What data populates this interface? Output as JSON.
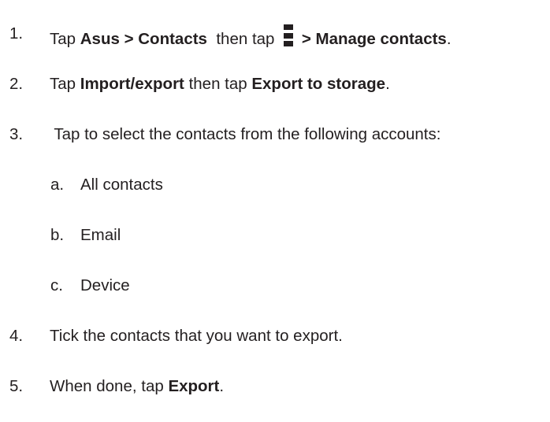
{
  "steps": [
    {
      "number": "1.",
      "t1": "Tap ",
      "b1": "Asus > Contacts",
      "t2": "  then tap ",
      "icon": "vertical-more-menu-icon",
      "b2": " > Manage contacts",
      "t3": "."
    },
    {
      "number": "2.",
      "t1": "Tap ",
      "b1": "Import/export",
      "t2": " then tap ",
      "b2": "Export to storage",
      "t3": "."
    },
    {
      "number": "3.",
      "t1": " Tap to select the contacts from the following accounts:"
    },
    {
      "number": "4.",
      "t1": "Tick the contacts that you want to export."
    },
    {
      "number": "5.",
      "t1": "When done, tap ",
      "b1": "Export",
      "t2": "."
    }
  ],
  "sub_steps": [
    {
      "letter": "a.",
      "text": "All contacts"
    },
    {
      "letter": "b.",
      "text": "Email"
    },
    {
      "letter": "c.",
      "text": "Device"
    }
  ]
}
